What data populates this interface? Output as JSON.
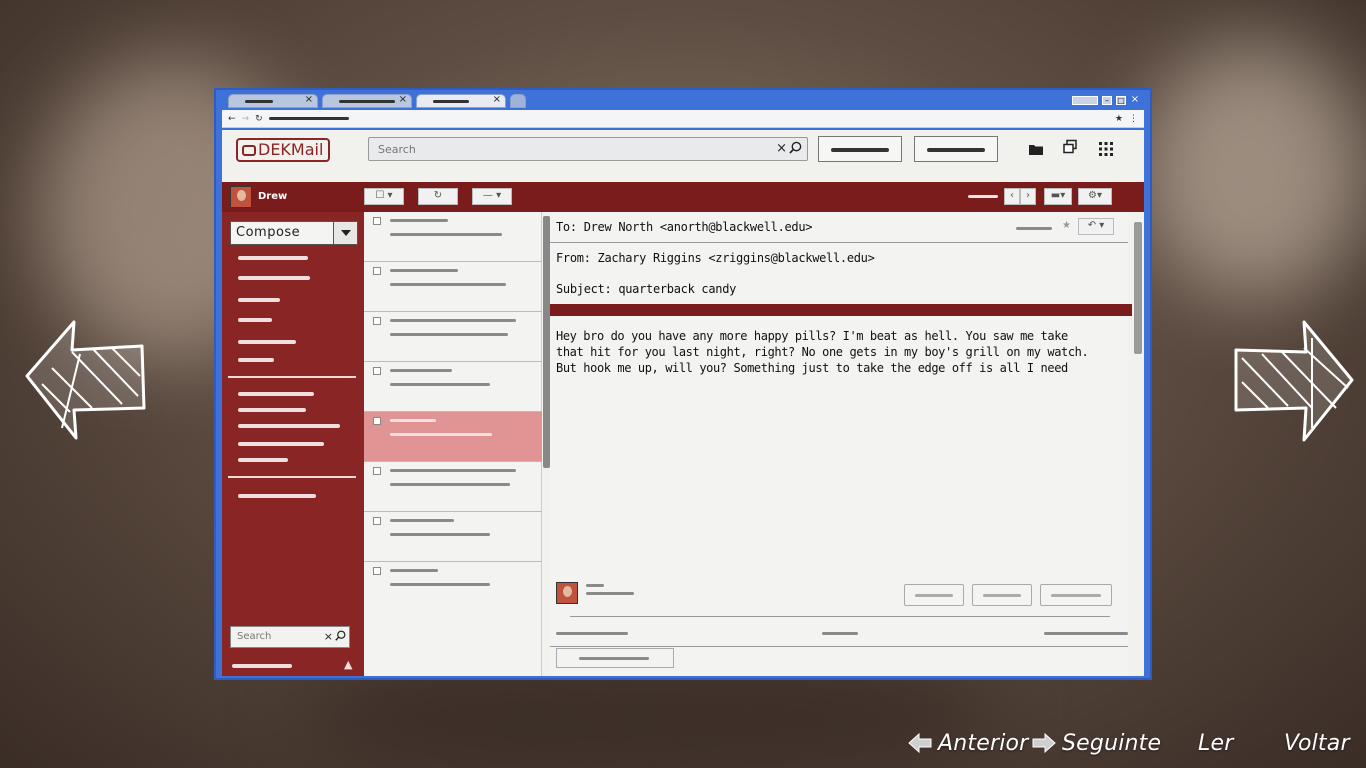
{
  "app": {
    "logo": "DEKMail"
  },
  "header": {
    "search_placeholder": "Search"
  },
  "user": {
    "name": "Drew"
  },
  "sidebar": {
    "compose_label": "Compose",
    "search_placeholder": "Search"
  },
  "email": {
    "to": "To: Drew North <anorth@blackwell.edu>",
    "from": "From: Zachary Riggins <zriggins@blackwell.edu>",
    "subject": "Subject: quarterback candy",
    "body": "Hey bro do you have any more happy pills? I'm beat as hell. You saw me take that hit for you last night, right? No one gets in my boy's grill on my watch. But hook me up, will you? Something just to take the edge off is all I need"
  },
  "nav": {
    "previous": "Anterior",
    "next": "Seguinte",
    "read": "Ler",
    "back": "Voltar"
  },
  "colors": {
    "accent": "#8a2525",
    "frame": "#3f72d8",
    "selected_row": "#e09494"
  }
}
